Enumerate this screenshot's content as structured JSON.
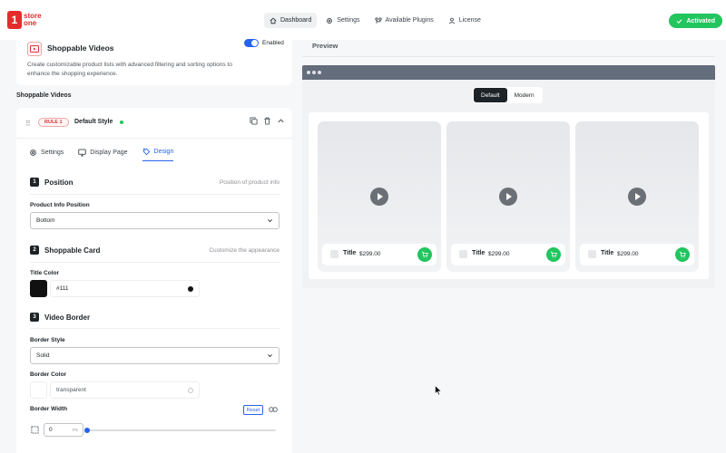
{
  "brand": {
    "line1": "store",
    "line2": "one"
  },
  "nav": [
    {
      "label": "Dashboard",
      "icon": "home-icon"
    },
    {
      "label": "Settings",
      "icon": "gear-icon"
    },
    {
      "label": "Available Plugins",
      "icon": "plugins-icon"
    },
    {
      "label": "License",
      "icon": "user-icon"
    }
  ],
  "status": {
    "activated": "Activated"
  },
  "module": {
    "title": "Shoppable Videos",
    "description": "Create customizable product lists with advanced filtering and sorting options to enhance the shopping experience.",
    "toggle_label": "Enabled"
  },
  "section_title": "Shoppable Videos",
  "rule": {
    "badge": "RULE 1",
    "name": "Default Style"
  },
  "tabs": [
    {
      "label": "Settings",
      "icon": "gear-icon"
    },
    {
      "label": "Display Page",
      "icon": "monitor-icon"
    },
    {
      "label": "Design",
      "icon": "brush-icon"
    }
  ],
  "steps": {
    "position": {
      "num": "1",
      "title": "Position",
      "hint": "Position of product info"
    },
    "card": {
      "num": "2",
      "title": "Shoppable Card",
      "hint": "Customize the appearance"
    },
    "border": {
      "num": "3",
      "title": "Video Border"
    }
  },
  "fields": {
    "product_info_position": {
      "label": "Product Info Position",
      "value": "Bottom"
    },
    "title_color": {
      "label": "Title Color",
      "value": "#111",
      "swatch": "#111111"
    },
    "border_style": {
      "label": "Border Style",
      "value": "Solid"
    },
    "border_color": {
      "label": "Border Color",
      "value": "transparent"
    },
    "border_width": {
      "label": "Border Width",
      "value": "0",
      "unit": "PX",
      "reset": "Reset",
      "slider_fraction": 0
    }
  },
  "preview": {
    "title": "Preview",
    "modes": [
      "Default",
      "Modern"
    ],
    "products": [
      {
        "title": "Title",
        "price": "$299.00"
      },
      {
        "title": "Title",
        "price": "$299.00"
      },
      {
        "title": "Title",
        "price": "$299.00"
      }
    ]
  },
  "colors": {
    "brand": "#e52b2b",
    "accent": "#2563eb",
    "success": "#22c55e"
  }
}
